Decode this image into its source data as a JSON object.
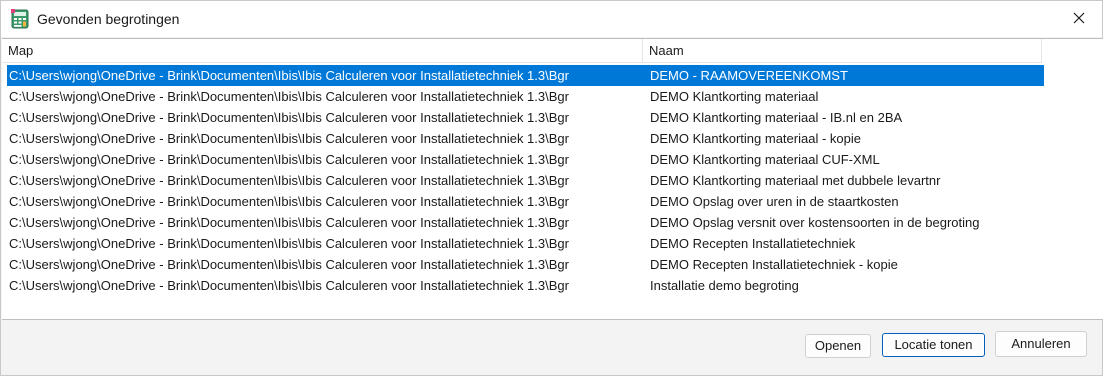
{
  "window": {
    "title": "Gevonden begrotingen"
  },
  "icons": {
    "app": "calculator-icon",
    "close": "close-icon"
  },
  "list": {
    "columns": [
      "Map",
      "Naam"
    ],
    "selected_index": 0,
    "rows": [
      {
        "map": "C:\\Users\\wjong\\OneDrive - Brink\\Documenten\\Ibis\\Ibis Calculeren voor Installatietechniek 1.3\\Bgr",
        "naam": "DEMO - RAAMOVEREENKOMST"
      },
      {
        "map": "C:\\Users\\wjong\\OneDrive - Brink\\Documenten\\Ibis\\Ibis Calculeren voor Installatietechniek 1.3\\Bgr",
        "naam": "DEMO Klantkorting materiaal"
      },
      {
        "map": "C:\\Users\\wjong\\OneDrive - Brink\\Documenten\\Ibis\\Ibis Calculeren voor Installatietechniek 1.3\\Bgr",
        "naam": "DEMO Klantkorting materiaal - IB.nl en 2BA"
      },
      {
        "map": "C:\\Users\\wjong\\OneDrive - Brink\\Documenten\\Ibis\\Ibis Calculeren voor Installatietechniek 1.3\\Bgr",
        "naam": "DEMO Klantkorting materiaal - kopie"
      },
      {
        "map": "C:\\Users\\wjong\\OneDrive - Brink\\Documenten\\Ibis\\Ibis Calculeren voor Installatietechniek 1.3\\Bgr",
        "naam": "DEMO Klantkorting materiaal CUF-XML"
      },
      {
        "map": "C:\\Users\\wjong\\OneDrive - Brink\\Documenten\\Ibis\\Ibis Calculeren voor Installatietechniek 1.3\\Bgr",
        "naam": "DEMO Klantkorting materiaal met dubbele levartnr"
      },
      {
        "map": "C:\\Users\\wjong\\OneDrive - Brink\\Documenten\\Ibis\\Ibis Calculeren voor Installatietechniek 1.3\\Bgr",
        "naam": "DEMO Opslag over uren in de staartkosten"
      },
      {
        "map": "C:\\Users\\wjong\\OneDrive - Brink\\Documenten\\Ibis\\Ibis Calculeren voor Installatietechniek 1.3\\Bgr",
        "naam": "DEMO Opslag versnit over kostensoorten in de begroting"
      },
      {
        "map": "C:\\Users\\wjong\\OneDrive - Brink\\Documenten\\Ibis\\Ibis Calculeren voor Installatietechniek 1.3\\Bgr",
        "naam": "DEMO Recepten Installatietechniek"
      },
      {
        "map": "C:\\Users\\wjong\\OneDrive - Brink\\Documenten\\Ibis\\Ibis Calculeren voor Installatietechniek 1.3\\Bgr",
        "naam": "DEMO Recepten Installatietechniek - kopie"
      },
      {
        "map": "C:\\Users\\wjong\\OneDrive - Brink\\Documenten\\Ibis\\Ibis Calculeren voor Installatietechniek 1.3\\Bgr",
        "naam": "Installatie demo begroting"
      }
    ]
  },
  "buttons": {
    "open": "Openen",
    "show_location": "Locatie tonen",
    "cancel": "Annuleren"
  },
  "colors": {
    "selection": "#0078d7",
    "default_button_border": "#005fb8"
  }
}
